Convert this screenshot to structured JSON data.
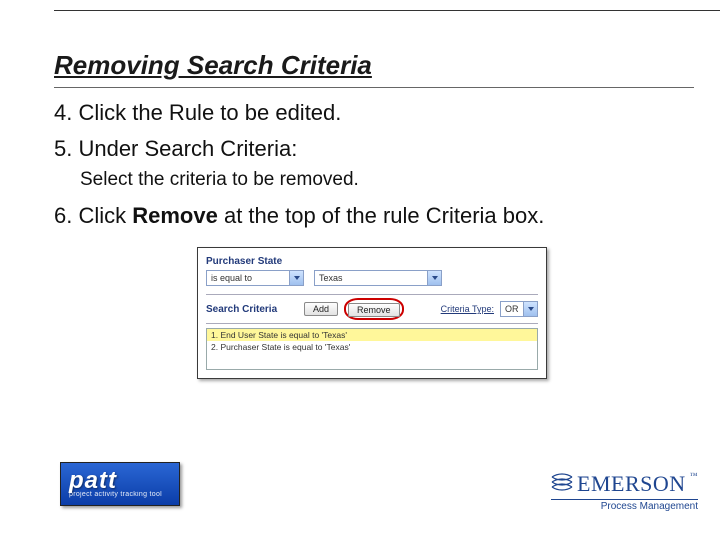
{
  "title": "Removing Search Criteria",
  "steps": {
    "s4": "4. Click the Rule to be edited.",
    "s5": "5. Under Search Criteria:",
    "s5sub": "Select the criteria to be removed.",
    "s6_pre": "6. Click ",
    "s6_bold": "Remove",
    "s6_post": " at the top of the rule Criteria box."
  },
  "shot": {
    "field_label": "Purchaser State",
    "operator": "is equal to",
    "value": "Texas",
    "sc_title": "Search Criteria",
    "add_btn": "Add",
    "remove_btn": "Remove",
    "criteria_type_label": "Criteria Type:",
    "criteria_type_value": "OR",
    "row1": "1. End User State is equal to 'Texas'",
    "row2": "2. Purchaser State is equal to 'Texas'"
  },
  "logos": {
    "patt_big": "patt",
    "patt_small": "project activity tracking tool",
    "emerson": "EMERSON",
    "emerson_sub": "Process Management"
  }
}
